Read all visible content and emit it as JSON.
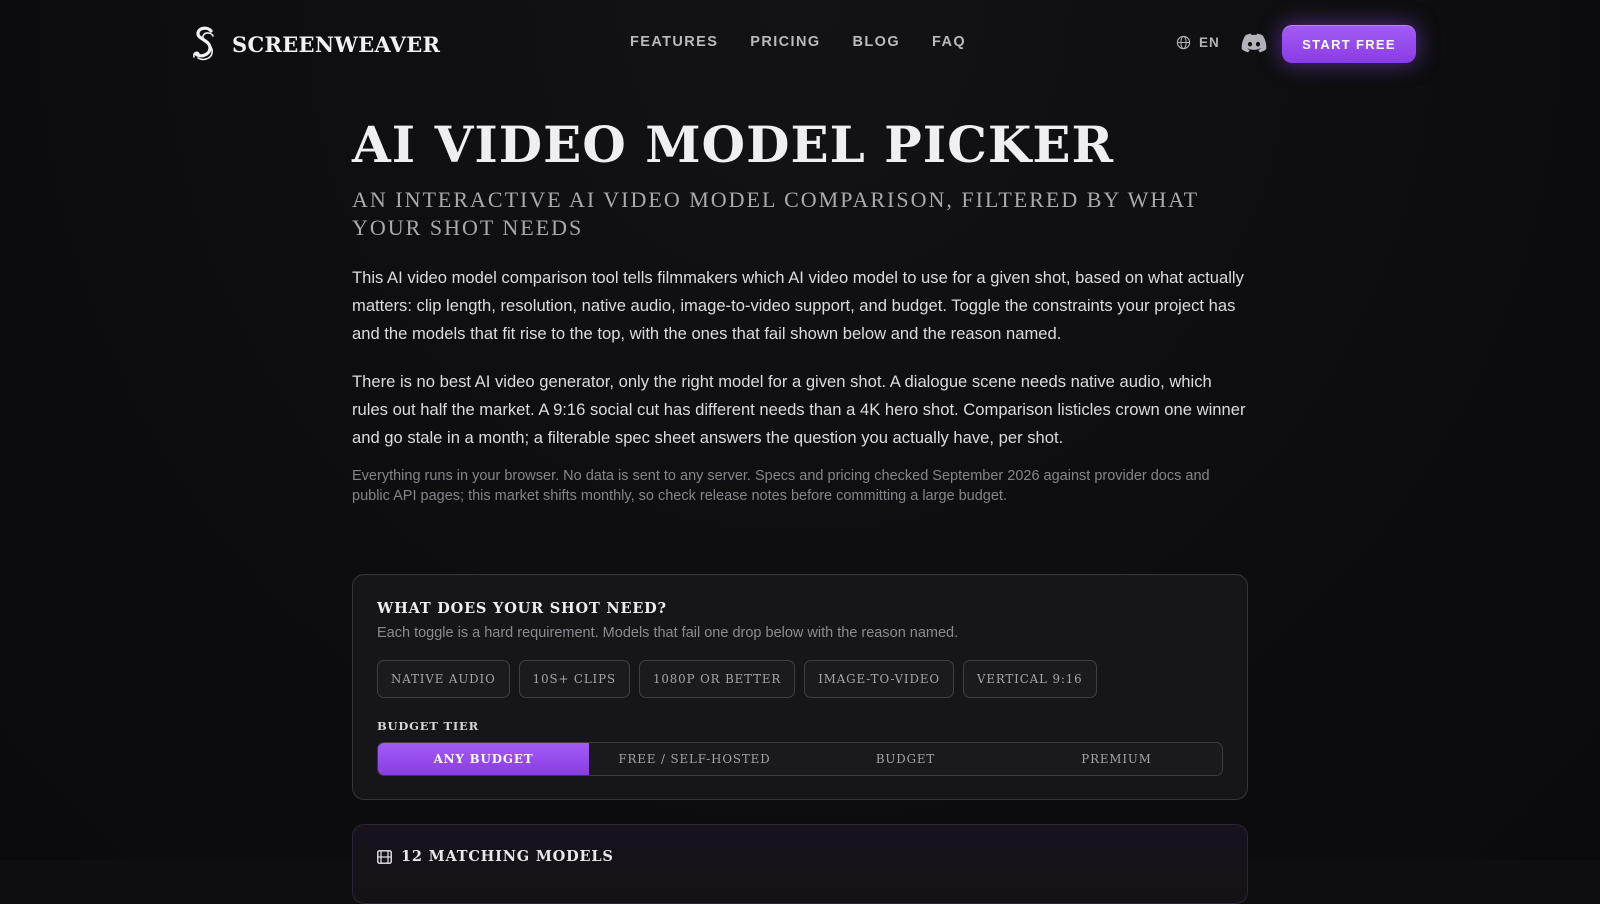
{
  "header": {
    "brand_name": "SCREENWEAVER",
    "nav": [
      "FEATURES",
      "PRICING",
      "BLOG",
      "FAQ"
    ],
    "language": "EN",
    "cta_label": "START FREE"
  },
  "colors": {
    "accent": "#9b4ff0",
    "background": "#0e0e10",
    "card": "#161618"
  },
  "icons": {
    "brand": "screenweaver-logo-icon",
    "language": "globe-icon",
    "social": "discord-icon",
    "results": "film-icon"
  },
  "main": {
    "title": "AI VIDEO MODEL PICKER",
    "subtitle": "AN INTERACTIVE AI VIDEO MODEL COMPARISON, FILTERED BY WHAT YOUR SHOT NEEDS",
    "paragraph_1": "This AI video model comparison tool tells filmmakers which AI video model to use for a given shot, based on what actually matters: clip length, resolution, native audio, image-to-video support, and budget. Toggle the constraints your project has and the models that fit rise to the top, with the ones that fail shown below and the reason named.",
    "paragraph_2": "There is no best AI video generator, only the right model for a given shot. A dialogue scene needs native audio, which rules out half the market. A 9:16 social cut has different needs than a 4K hero shot. Comparison listicles crown one winner and go stale in a month; a filterable spec sheet answers the question you actually have, per shot.",
    "note": "Everything runs in your browser. No data is sent to any server. Specs and pricing checked September 2026 against provider docs and public API pages; this market shifts monthly, so check release notes before committing a large budget."
  },
  "filters": {
    "heading": "WHAT DOES YOUR SHOT NEED?",
    "subheading": "Each toggle is a hard requirement. Models that fail one drop below with the reason named.",
    "toggles": [
      "NATIVE AUDIO",
      "10S+ CLIPS",
      "1080P OR BETTER",
      "IMAGE-TO-VIDEO",
      "VERTICAL 9:16"
    ],
    "budget_label": "BUDGET TIER",
    "budget_options": [
      "ANY BUDGET",
      "FREE / SELF-HOSTED",
      "BUDGET",
      "PREMIUM"
    ],
    "budget_selected": "ANY BUDGET"
  },
  "results": {
    "count_label": "12 MATCHING MODELS"
  }
}
